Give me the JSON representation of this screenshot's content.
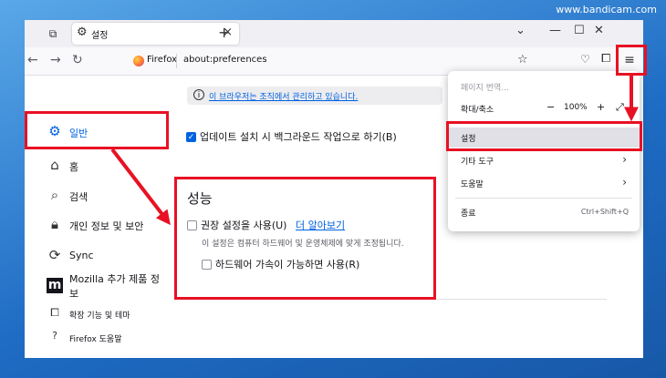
{
  "watermark": "www.bandicam.com",
  "tab": {
    "title": "설정"
  },
  "address": {
    "identity": "Firefox",
    "url": "about:preferences"
  },
  "managed_notice": "이 브라우저는 조직에서 관리하고 있습니다.",
  "sidebar": {
    "items": [
      {
        "label": "일반",
        "icon": "gear-icon"
      },
      {
        "label": "홈",
        "icon": "home-icon"
      },
      {
        "label": "검색",
        "icon": "search-icon"
      },
      {
        "label": "개인 정보 및 보안",
        "icon": "lock-icon"
      },
      {
        "label": "Sync",
        "icon": "sync-icon"
      },
      {
        "label": "Mozilla 추가 제품 정보",
        "label_line1": "Mozilla 추가 제품 정",
        "label_line2": "보",
        "icon": "mozilla-icon"
      },
      {
        "label": "확장 기능 및 테마",
        "icon": "puzzle-icon"
      },
      {
        "label": "Firefox 도움말",
        "icon": "help-icon"
      }
    ]
  },
  "update_option": "업데이트 설치 시 백그라운드 작업으로 하기(B)",
  "performance": {
    "title": "성능",
    "recommended_label": "권장 설정을 사용(U)",
    "learn_more": "더 알아보기",
    "hint": "이 설정은 컴퓨터 하드웨어 및 운영체제에 맞게 조정됩니다.",
    "hw_accel_label": "하드웨어 가속이 가능하면 사용(R)"
  },
  "app_menu": {
    "translate": "페이지 번역...",
    "zoom_label": "확대/축소",
    "zoom_value": "100%",
    "zoom_minus": "−",
    "zoom_plus": "+",
    "settings": "설정",
    "more_tools": "기타 도구",
    "help": "도움말",
    "quit": "종료",
    "quit_shortcut": "Ctrl+Shift+Q"
  },
  "colors": {
    "accent": "#0061e0",
    "highlight_box": "#e81123"
  }
}
